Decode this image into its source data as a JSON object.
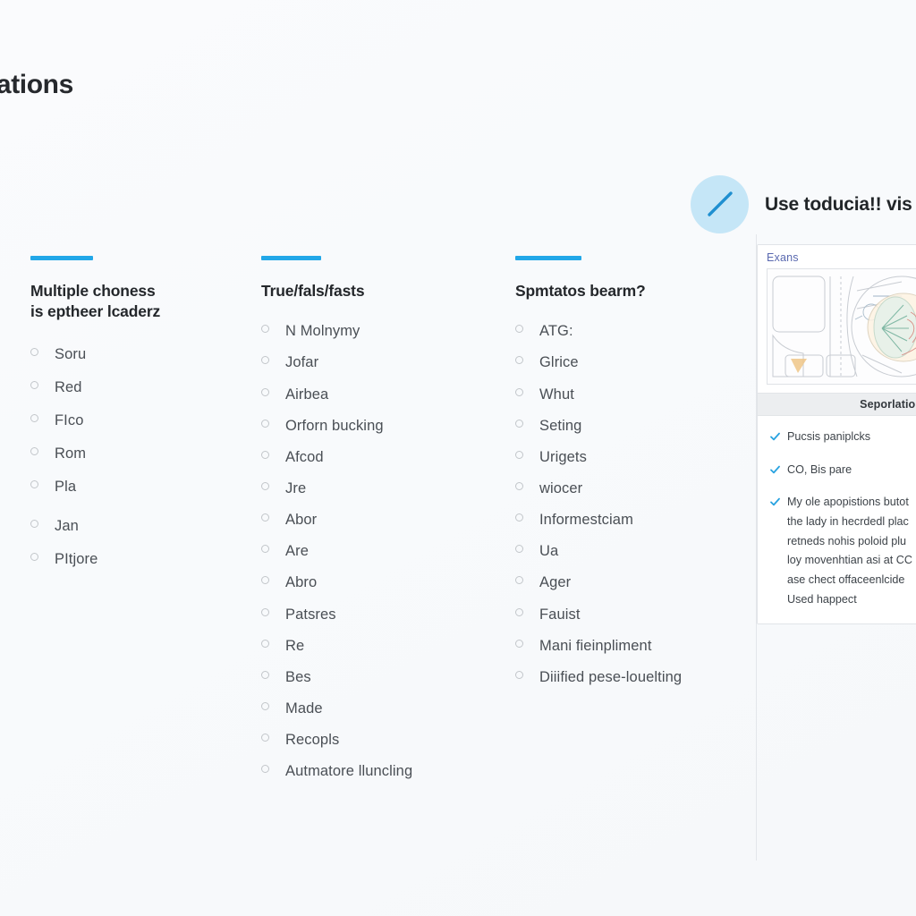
{
  "page": {
    "title": "lations"
  },
  "columns": [
    {
      "id": "multiple-choice",
      "accent_color": "#22a7e8",
      "heading": "Multiple choness\nis eptheer lcaderz",
      "options": [
        {
          "label": "Soru",
          "spaced_before": false
        },
        {
          "label": "Red",
          "spaced_before": false
        },
        {
          "label": "FIco",
          "spaced_before": false
        },
        {
          "label": "Rom",
          "spaced_before": false
        },
        {
          "label": "Pla",
          "spaced_before": false
        },
        {
          "label": "Jan",
          "spaced_before": true
        },
        {
          "label": "PItjore",
          "spaced_before": false
        }
      ]
    },
    {
      "id": "true-false",
      "accent_color": "#22a7e8",
      "heading": "True/fals/fasts",
      "options": [
        {
          "label": "N Molnymy",
          "spaced_before": false
        },
        {
          "label": "Jofar",
          "spaced_before": false
        },
        {
          "label": "Airbea",
          "spaced_before": false
        },
        {
          "label": "Orforn bucking",
          "spaced_before": false
        },
        {
          "label": "Afcod",
          "spaced_before": false
        },
        {
          "label": "Jre",
          "spaced_before": false
        },
        {
          "label": "Abor",
          "spaced_before": false
        },
        {
          "label": "Are",
          "spaced_before": false
        },
        {
          "label": "Abro",
          "spaced_before": false
        },
        {
          "label": "Patsres",
          "spaced_before": false
        },
        {
          "label": "Re",
          "spaced_before": false
        },
        {
          "label": "Bes",
          "spaced_before": false
        },
        {
          "label": "Made",
          "spaced_before": false
        },
        {
          "label": "Recopls",
          "spaced_before": false
        },
        {
          "label": "Autmatore lluncling",
          "spaced_before": false
        }
      ]
    },
    {
      "id": "short-answer",
      "accent_color": "#22a7e8",
      "heading": "Spmtatos bearm?",
      "options": [
        {
          "label": "ATG:",
          "spaced_before": false
        },
        {
          "label": "Glrice",
          "spaced_before": false
        },
        {
          "label": "Whut",
          "spaced_before": false
        },
        {
          "label": "Seting",
          "spaced_before": false
        },
        {
          "label": "Urigets",
          "spaced_before": false
        },
        {
          "label": "wiocer",
          "spaced_before": false
        },
        {
          "label": "Informestciam",
          "spaced_before": false
        },
        {
          "label": "Ua",
          "spaced_before": false
        },
        {
          "label": "Ager",
          "spaced_before": false
        },
        {
          "label": "Fauist",
          "spaced_before": false
        },
        {
          "label": "Mani fieinpliment",
          "spaced_before": false
        },
        {
          "label": "Diiified pese-louelting",
          "spaced_before": false
        }
      ]
    }
  ],
  "right_panel": {
    "icon": "pencil-icon",
    "icon_circle_color": "#c5e6f7",
    "icon_stroke_color": "#1f8fd0",
    "heading": "Use toducia!! vis",
    "card": {
      "tab_label": "Exans",
      "thumbnail": "anatomy-diagram",
      "section_label": "Seporlation",
      "checks": [
        {
          "icon": "check-icon",
          "color": "#29a3e0",
          "text": "Pucsis paniplcks"
        },
        {
          "icon": "check-icon",
          "color": "#29a3e0",
          "text": "CO, Bis pare"
        },
        {
          "icon": "check-icon",
          "color": "#29a3e0",
          "text": "My ole apopistions butot\nthe lady in hecrdedl plac\nretneds nohis poloid plu\nloy movenhtian asi at CC\nase chect offaceenlcide\nUsed happect"
        }
      ]
    }
  }
}
